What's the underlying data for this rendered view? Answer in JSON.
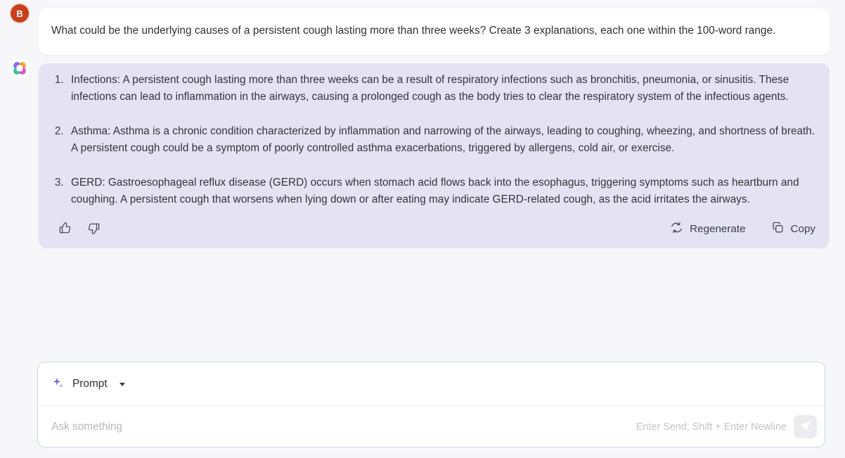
{
  "conversation": {
    "user_message": {
      "avatar_initial": "B",
      "avatar_color": "#c8401a",
      "text": "What could be the underlying causes of a persistent cough lasting more than three weeks? Create 3 explanations, each one within the 100-word range."
    },
    "assistant_message": {
      "avatar_icon": "sparkle-clover-icon",
      "bubble_color": "#e4e2f3",
      "items": [
        "Infections: A persistent cough lasting more than three weeks can be a result of respiratory infections such as bronchitis, pneumonia, or sinusitis. These infections can lead to inflammation in the airways, causing a prolonged cough as the body tries to clear the respiratory system of the infectious agents.",
        "Asthma: Asthma is a chronic condition characterized by inflammation and narrowing of the airways, leading to coughing, wheezing, and shortness of breath. A persistent cough could be a symptom of poorly controlled asthma exacerbations, triggered by allergens, cold air, or exercise.",
        "GERD: Gastroesophageal reflux disease (GERD) occurs when stomach acid flows back into the esophagus, triggering symptoms such as heartburn and coughing. A persistent cough that worsens when lying down or after eating may indicate GERD-related cough, as the acid irritates the airways."
      ],
      "actions": {
        "thumbs_up_icon": "thumbs-up-icon",
        "thumbs_down_icon": "thumbs-down-icon",
        "regenerate_label": "Regenerate",
        "regenerate_icon": "refresh-icon",
        "copy_label": "Copy",
        "copy_icon": "copy-icon"
      }
    }
  },
  "composer": {
    "prompt_label": "Prompt",
    "prompt_icon": "sparkle-icon",
    "dropdown_icon": "chevron-down-icon",
    "input_value": "",
    "input_placeholder": "Ask something",
    "send_hint": "Enter Send; Shift + Enter Newline",
    "send_icon": "send-paper-plane-icon",
    "border_color": "#c9d6ea"
  }
}
